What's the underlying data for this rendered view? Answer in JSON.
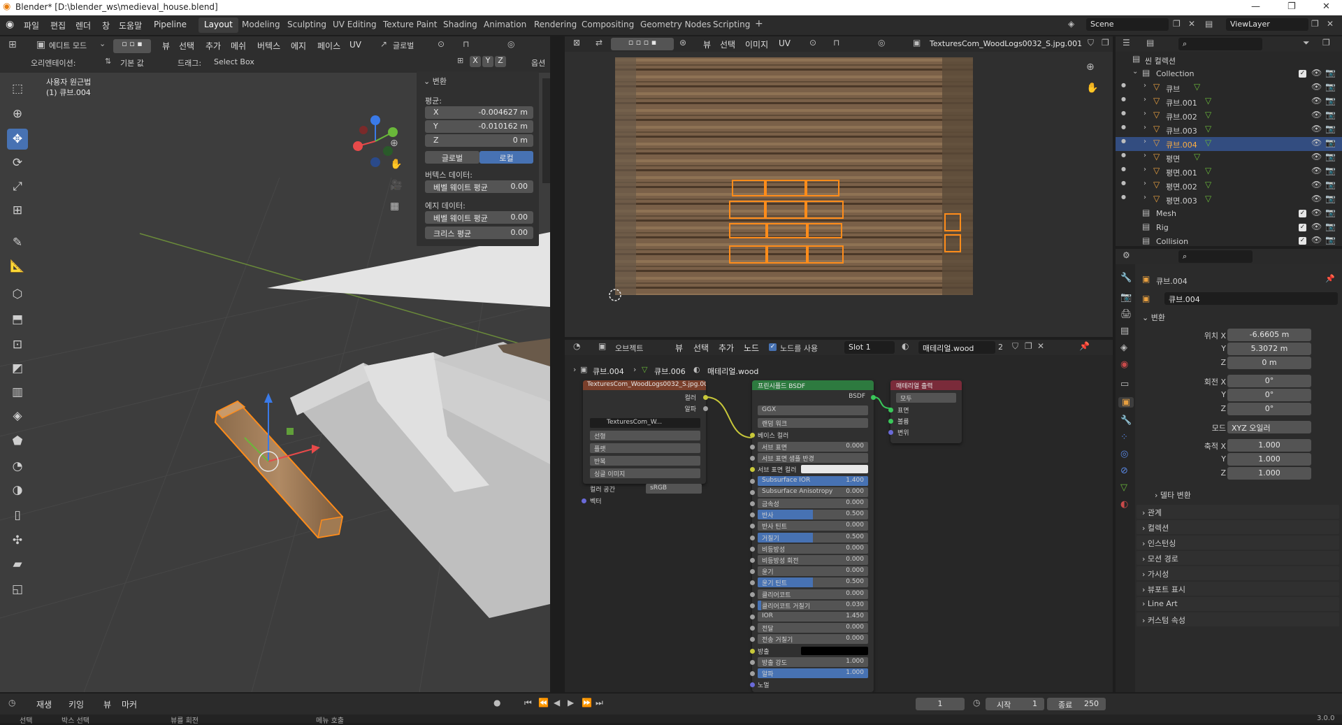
{
  "window": {
    "title": "Blender* [D:\\blender_ws\\medieval_house.blend]",
    "minimize": "—",
    "maximize": "❐",
    "close": "✕"
  },
  "menu": [
    "파일",
    "편집",
    "렌더",
    "창",
    "도움말",
    "Pipeline"
  ],
  "workspaces": [
    "Layout",
    "Modeling",
    "Sculpting",
    "UV Editing",
    "Texture Paint",
    "Shading",
    "Animation",
    "Rendering",
    "Compositing",
    "Geometry Nodes",
    "Scripting"
  ],
  "active_workspace": "Layout",
  "scene": {
    "name": "Scene",
    "view_layer": "ViewLayer"
  },
  "viewport": {
    "mode": "에디트 모드",
    "menus": [
      "뷰",
      "선택",
      "추가",
      "메쉬",
      "버텍스",
      "에지",
      "페이스",
      "UV"
    ],
    "orientation_label": "오리엔테이션:",
    "orientation_value": "기본 값",
    "drag_label": "드래그:",
    "drag_value": "Select Box",
    "transform_orient": "글로벌",
    "axes": [
      "X",
      "Y",
      "Z"
    ],
    "options": "옵션",
    "view_name": "사용자 원근법",
    "object_name": "(1) 큐브.004"
  },
  "npanel": {
    "header": "변환",
    "median": "평균:",
    "x_label": "X",
    "x": "-0.004627 m",
    "y_label": "Y",
    "y": "-0.010162 m",
    "z_label": "Z",
    "z": "0 m",
    "global": "글로벌",
    "local": "로컬",
    "vertex_data": "버텍스 데이터:",
    "bevel_w": "베벨 웨이트 평균",
    "bevel_w_val": "0.00",
    "edge_data": "에지 데이터:",
    "edge_bevel": "베벨 웨이트 평균",
    "edge_bevel_val": "0.00",
    "crease": "크리스 평균",
    "crease_val": "0.00"
  },
  "image_editor": {
    "menus": [
      "뷰",
      "선택",
      "이미지",
      "UV"
    ],
    "image": "TexturesCom_WoodLogs0032_S.jpg.001"
  },
  "node_editor": {
    "type": "오브젝트",
    "menus": [
      "뷰",
      "선택",
      "추가",
      "노드"
    ],
    "use_nodes": "노드를 사용",
    "slot": "Slot 1",
    "material": "매테리얼.wood",
    "users": "2",
    "breadcrumb": [
      "큐브.004",
      "큐브.006",
      "매테리얼.wood"
    ],
    "tex_node": {
      "title": "TexturesCom_WoodLogs0032_S.jpg.00",
      "out_color": "컬러",
      "out_alpha": "알파",
      "image": "TexturesCom_W...",
      "interp": "선형",
      "proj": "플랫",
      "ext": "반복",
      "src": "싱글 이미지",
      "cs_label": "컬러 공간",
      "cs": "sRGB",
      "vector": "벡터"
    },
    "bsdf_node": {
      "title": "프린시플드 BSDF",
      "out": "BSDF",
      "dist": "GGX",
      "sss": "랜덤 워크",
      "base_color": "베이스 컬러",
      "rows": [
        {
          "name": "서브 표면",
          "value": "0.000",
          "fill": 0
        },
        {
          "name": "서브 표면 샘플 반경",
          "value": "",
          "fill": 0,
          "dropdown": true
        },
        {
          "name": "서브 표면 컬러",
          "value": "",
          "fill": 0,
          "swatch": "#e8e8e8"
        },
        {
          "name": "Subsurface IOR",
          "value": "1.400",
          "fill": 1
        },
        {
          "name": "Subsurface Anisotropy",
          "value": "0.000",
          "fill": 0
        },
        {
          "name": "금속성",
          "value": "0.000",
          "fill": 0
        },
        {
          "name": "반사",
          "value": "0.500",
          "fill": 0.5
        },
        {
          "name": "반사 틴트",
          "value": "0.000",
          "fill": 0
        },
        {
          "name": "거칠기",
          "value": "0.500",
          "fill": 0.5
        },
        {
          "name": "비등방성",
          "value": "0.000",
          "fill": 0
        },
        {
          "name": "비등방성 회전",
          "value": "0.000",
          "fill": 0
        },
        {
          "name": "윤기",
          "value": "0.000",
          "fill": 0
        },
        {
          "name": "윤기 틴트",
          "value": "0.500",
          "fill": 0.5
        },
        {
          "name": "클리어코트",
          "value": "0.000",
          "fill": 0
        },
        {
          "name": "클리어코트 거칠기",
          "value": "0.030",
          "fill": 0.03
        },
        {
          "name": "IOR",
          "value": "1.450",
          "fill": 0
        },
        {
          "name": "전달",
          "value": "0.000",
          "fill": 0
        },
        {
          "name": "전송 거칠기",
          "value": "0.000",
          "fill": 0
        },
        {
          "name": "방출",
          "value": "",
          "fill": 0,
          "swatch": "#000000"
        },
        {
          "name": "방출 강도",
          "value": "1.000",
          "fill": 0
        },
        {
          "name": "알파",
          "value": "1.000",
          "fill": 1
        },
        {
          "name": "노멀",
          "value": "",
          "fill": 0,
          "plain": true
        }
      ]
    },
    "out_node": {
      "title": "매테리얼 출력",
      "target": "모두",
      "inputs": [
        "표면",
        "볼륨",
        "변위"
      ]
    }
  },
  "outliner": {
    "root": "씬 컬렉션",
    "collection": "Collection",
    "items": [
      {
        "name": "큐브",
        "selected": false
      },
      {
        "name": "큐브.001",
        "selected": false
      },
      {
        "name": "큐브.002",
        "selected": false
      },
      {
        "name": "큐브.003",
        "selected": false
      },
      {
        "name": "큐브.004",
        "selected": true
      },
      {
        "name": "평면",
        "selected": false
      },
      {
        "name": "평면.001",
        "selected": false
      },
      {
        "name": "평면.002",
        "selected": false
      },
      {
        "name": "평면.003",
        "selected": false
      }
    ],
    "collections": [
      "Mesh",
      "Rig",
      "Collision"
    ]
  },
  "properties": {
    "object": "큐브.004",
    "data_name": "큐브.004",
    "transform": "변환",
    "loc_label": "위치 X",
    "loc_x": "-6.6605 m",
    "loc_y": "5.3072 m",
    "loc_z": "0 m",
    "rot_label": "회전 X",
    "rot_x": "0°",
    "rot_y": "0°",
    "rot_z": "0°",
    "mode_label": "모드",
    "mode": "XYZ 오일러",
    "scale_label": "축적 X",
    "scale_x": "1.000",
    "scale_y": "1.000",
    "scale_z": "1.000",
    "y": "Y",
    "z": "Z",
    "delta": "델타 변환",
    "sections": [
      "관계",
      "컬렉션",
      "인스턴싱",
      "모션 경로",
      "가시성",
      "뷰포트 표시",
      "Line Art",
      "커스텀 속성"
    ]
  },
  "timeline": {
    "menus": [
      "재생",
      "키잉",
      "뷰",
      "마커"
    ],
    "frame": "1",
    "start_label": "시작",
    "start": "1",
    "end_label": "종료",
    "end": "250"
  },
  "status": {
    "select": "선택",
    "box": "박스 선택",
    "rotate": "뷰를 회전",
    "menu": "메뉴 호출",
    "version": "3.0.0"
  },
  "colors": {
    "accent": "#4772b3",
    "select_orange": "#ff8c1a",
    "node_tex": "#7a3f2b",
    "node_shader": "#2d7a3f",
    "node_output": "#7a2b3a"
  }
}
